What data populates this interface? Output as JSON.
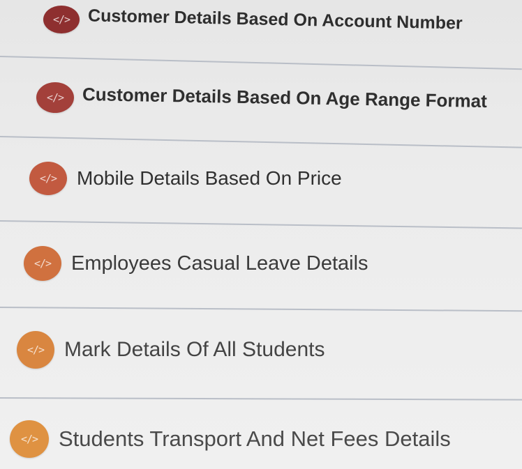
{
  "items": [
    {
      "label": "Customer Details Based On Account Number",
      "icon": "code-icon",
      "icon_color": "#8e2f2f"
    },
    {
      "label": "Customer Details Based On Age Range Format",
      "icon": "code-icon",
      "icon_color": "#a3403a"
    },
    {
      "label": "Mobile Details Based On Price",
      "icon": "code-icon",
      "icon_color": "#c25a40"
    },
    {
      "label": "Employees Casual Leave Details",
      "icon": "code-icon",
      "icon_color": "#d0713f"
    },
    {
      "label": "Mark Details Of All Students",
      "icon": "code-icon",
      "icon_color": "#d98640"
    },
    {
      "label": "Students Transport And Net Fees Details",
      "icon": "code-icon",
      "icon_color": "#df9242"
    }
  ],
  "icon_glyph": "</>"
}
